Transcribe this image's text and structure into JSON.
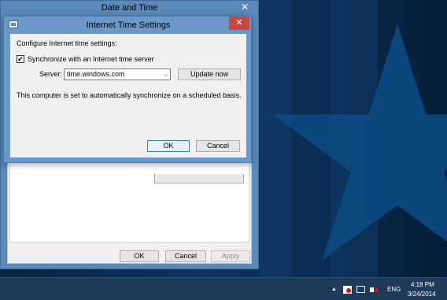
{
  "date_time_window": {
    "title": "Date and Time",
    "close_glyph": "✕",
    "buttons": {
      "ok": "OK",
      "cancel": "Cancel",
      "apply": "Apply"
    }
  },
  "internet_time_dialog": {
    "title": "Internet Time Settings",
    "close_glyph": "✕",
    "heading": "Configure Internet time settings:",
    "sync_checkbox": {
      "label": "Synchronize with an Internet time server",
      "checked": true,
      "glyph": "✔"
    },
    "server": {
      "label": "Server:",
      "value": "time.windows.com",
      "arrow": "⌵"
    },
    "update_button": "Update now",
    "status_text": "This computer is set to automatically synchronize on a scheduled basis.",
    "buttons": {
      "ok": "OK",
      "cancel": "Cancel"
    }
  },
  "taskbar": {
    "tray_up_arrow": "▲",
    "language": "ENG",
    "time": "4:18 PM",
    "date": "3/24/2014"
  }
}
